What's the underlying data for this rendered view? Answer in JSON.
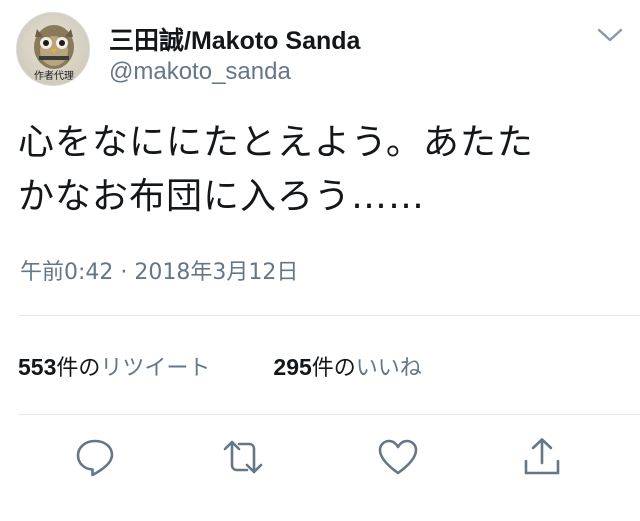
{
  "header": {
    "display_name": "三田誠/Makoto Sanda",
    "handle": "@makoto_sanda",
    "avatar_caption": "作者代理",
    "avatar_icon": "owl-avatar-icon",
    "menu_icon": "chevron-down-icon"
  },
  "tweet": {
    "line1": "心をなににたとえよう。あたた",
    "line2": "かなお布団に入ろう……"
  },
  "timestamp": "午前0:42 · 2018年3月12日",
  "stats": {
    "retweets": {
      "count": "553",
      "unit": "件の",
      "label": "リツイート"
    },
    "likes": {
      "count": "295",
      "unit": "件の",
      "label": "いいね"
    }
  },
  "actions": {
    "reply_icon": "reply-icon",
    "retweet_icon": "retweet-icon",
    "like_icon": "heart-icon",
    "share_icon": "share-icon"
  },
  "colors": {
    "text": "#14171a",
    "secondary": "#657786",
    "divider": "#e1e8ed"
  }
}
